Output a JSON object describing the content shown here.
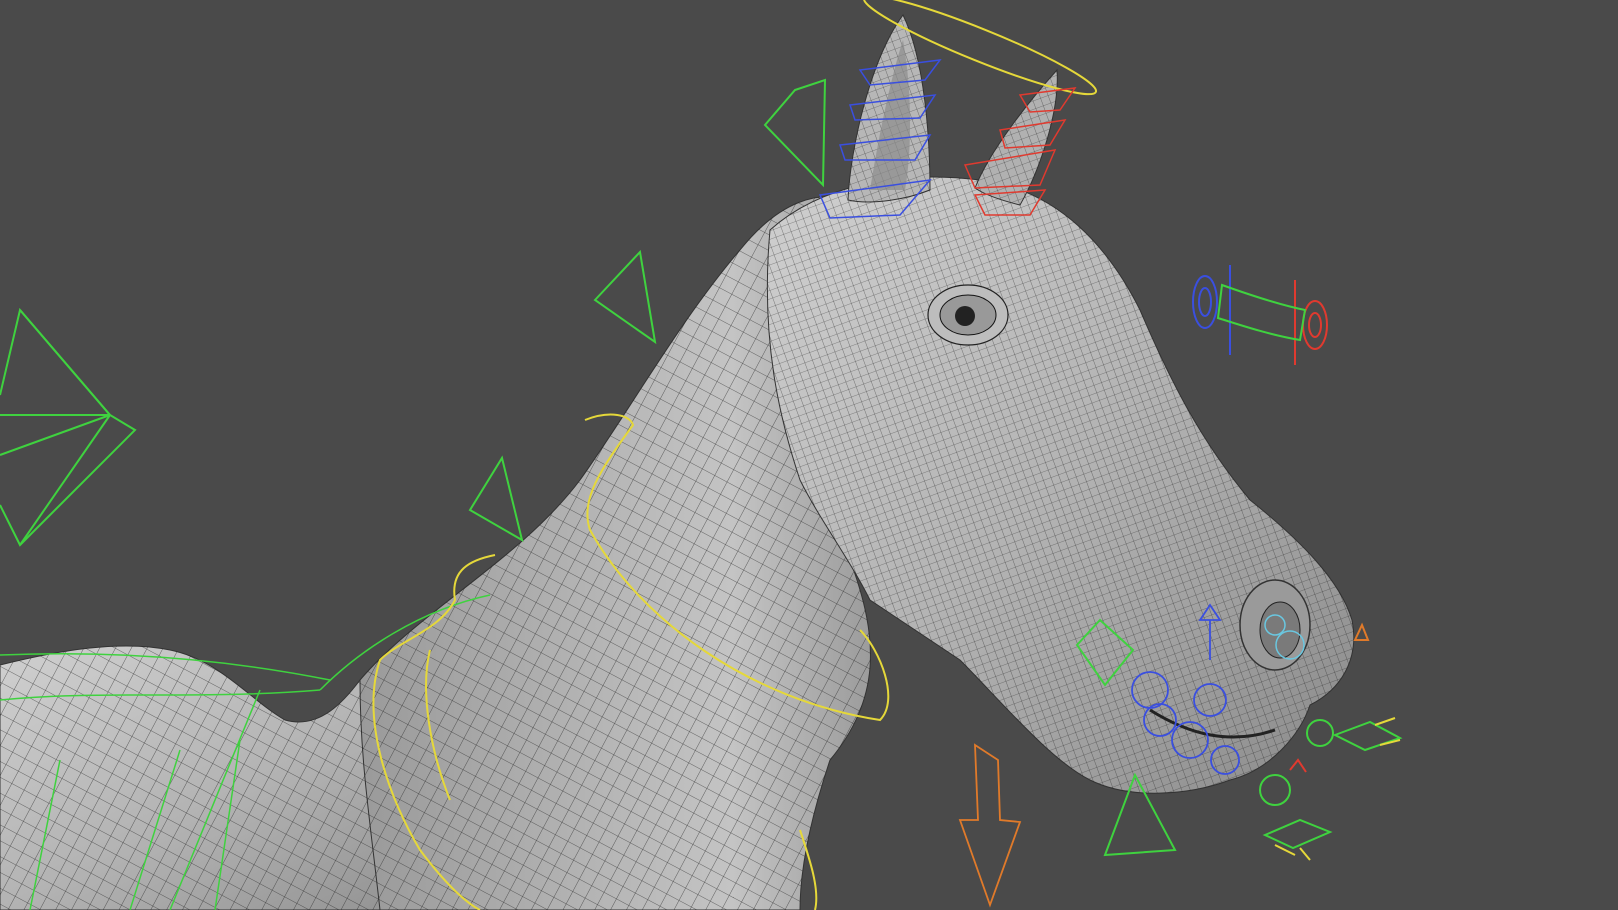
{
  "viewport": {
    "background": "#4a4a4a",
    "mesh_colors": {
      "surface_light": "#c9c9c9",
      "surface_mid": "#a6a6a6",
      "surface_dark": "#6e6e6e",
      "wireframe": "#1a1a1a"
    },
    "control_colors": {
      "green": "#3fd23f",
      "yellow": "#e5d83a",
      "blue": "#3a4fe0",
      "red": "#e03a2f",
      "orange": "#e07a2a",
      "cyan": "#6ac7e0"
    },
    "icons": [
      "horse-mesh",
      "ear-ik-controls",
      "head-aim-control",
      "neck-ring-control",
      "jaw-controls",
      "mouth-corner-controls",
      "eye-aim-control",
      "down-arrow-control"
    ]
  }
}
